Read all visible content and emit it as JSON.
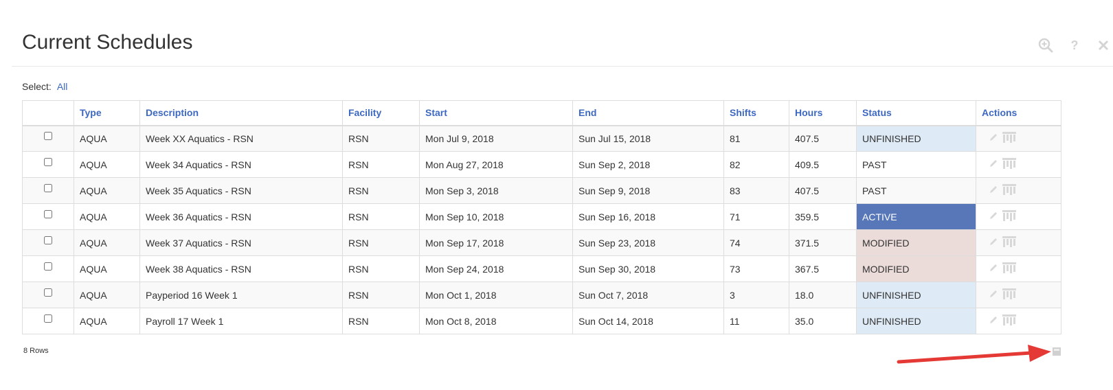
{
  "header": {
    "title": "Current Schedules",
    "icons": [
      "zoom-in-icon",
      "help-icon",
      "close-icon"
    ]
  },
  "select": {
    "label": "Select:",
    "all_link": "All"
  },
  "table": {
    "columns": [
      "",
      "Type",
      "Description",
      "Facility",
      "Start",
      "End",
      "Shifts",
      "Hours",
      "Status",
      "Actions"
    ],
    "rows": [
      {
        "type": "AQUA",
        "description": "Week XX Aquatics - RSN",
        "facility": "RSN",
        "start": "Mon Jul 9, 2018",
        "end": "Sun Jul 15, 2018",
        "shifts": "81",
        "hours": "407.5",
        "status": "UNFINISHED"
      },
      {
        "type": "AQUA",
        "description": "Week 34 Aquatics - RSN",
        "facility": "RSN",
        "start": "Mon Aug 27, 2018",
        "end": "Sun Sep 2, 2018",
        "shifts": "82",
        "hours": "409.5",
        "status": "PAST"
      },
      {
        "type": "AQUA",
        "description": "Week 35 Aquatics - RSN",
        "facility": "RSN",
        "start": "Mon Sep 3, 2018",
        "end": "Sun Sep 9, 2018",
        "shifts": "83",
        "hours": "407.5",
        "status": "PAST"
      },
      {
        "type": "AQUA",
        "description": "Week 36 Aquatics - RSN",
        "facility": "RSN",
        "start": "Mon Sep 10, 2018",
        "end": "Sun Sep 16, 2018",
        "shifts": "71",
        "hours": "359.5",
        "status": "ACTIVE"
      },
      {
        "type": "AQUA",
        "description": "Week 37 Aquatics - RSN",
        "facility": "RSN",
        "start": "Mon Sep 17, 2018",
        "end": "Sun Sep 23, 2018",
        "shifts": "74",
        "hours": "371.5",
        "status": "MODIFIED"
      },
      {
        "type": "AQUA",
        "description": "Week 38 Aquatics - RSN",
        "facility": "RSN",
        "start": "Mon Sep 24, 2018",
        "end": "Sun Sep 30, 2018",
        "shifts": "73",
        "hours": "367.5",
        "status": "MODIFIED"
      },
      {
        "type": "AQUA",
        "description": "Payperiod 16 Week 1",
        "facility": "RSN",
        "start": "Mon Oct 1, 2018",
        "end": "Sun Oct 7, 2018",
        "shifts": "3",
        "hours": "18.0",
        "status": "UNFINISHED"
      },
      {
        "type": "AQUA",
        "description": "Payroll 17 Week 1",
        "facility": "RSN",
        "start": "Mon Oct 8, 2018",
        "end": "Sun Oct 14, 2018",
        "shifts": "11",
        "hours": "35.0",
        "status": "UNFINISHED"
      }
    ]
  },
  "footer": {
    "rows_label": "8 Rows",
    "icon": "export-icon"
  },
  "colors": {
    "link": "#3d68c1",
    "active": "#5777b8",
    "unfinished": "#deeaf5",
    "modified": "#ebdcd9",
    "arrow": "#e53935"
  }
}
